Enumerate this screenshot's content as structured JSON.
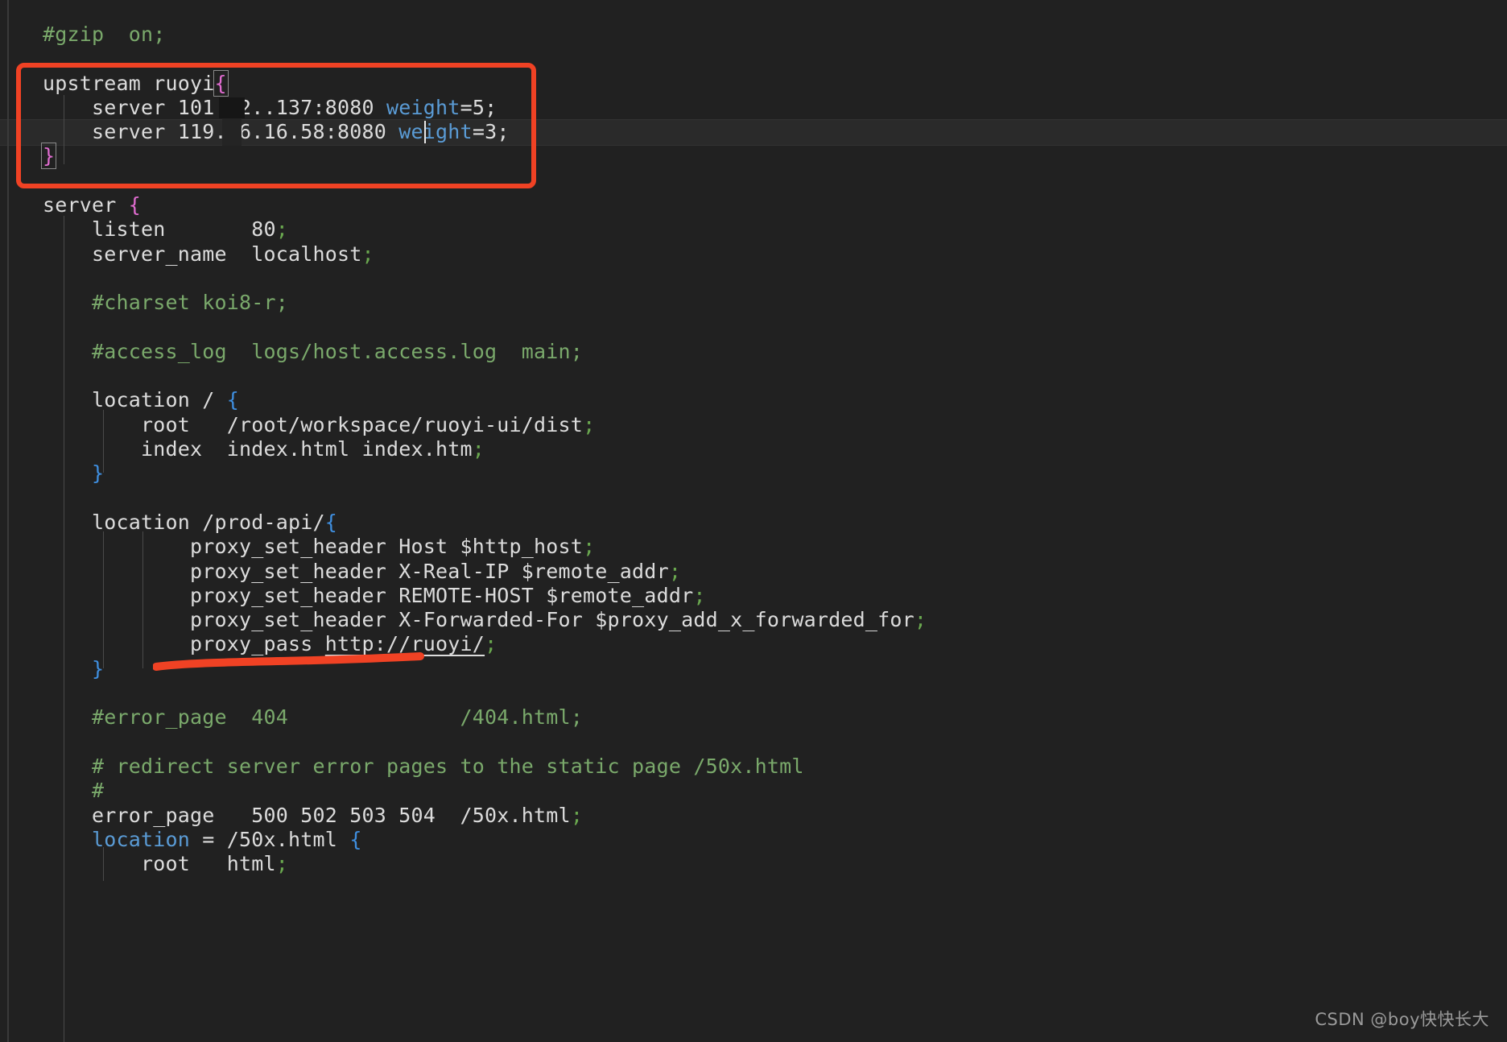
{
  "editor": {
    "background_color": "#212121",
    "foreground_color": "#d6d6d6",
    "comment_color": "#7aa96b",
    "keyword_color": "#5a9bd5",
    "brace_blue_color": "#3f8fe0",
    "brace_magenta_color": "#e06cd0",
    "punctuation_color": "#6aa84f",
    "annotation_color": "#f04224",
    "current_line_color": "#2a2a2a"
  },
  "code": {
    "language": "nginx",
    "lines": [
      {
        "id": "l01",
        "text": "#gzip  on;"
      },
      {
        "id": "l02",
        "text": ""
      },
      {
        "id": "l03",
        "text": "upstream ruoyi{"
      },
      {
        "id": "l04",
        "text": "    server 101.42.   .137:8080 weight=5;"
      },
      {
        "id": "l05",
        "text": "    server 119.96.1 6.58:8080 weight=3;"
      },
      {
        "id": "l06",
        "text": "}"
      },
      {
        "id": "l07",
        "text": ""
      },
      {
        "id": "l08",
        "text": "server {"
      },
      {
        "id": "l09",
        "text": "    listen       80;"
      },
      {
        "id": "l10",
        "text": "    server_name  localhost;"
      },
      {
        "id": "l11",
        "text": ""
      },
      {
        "id": "l12",
        "text": "    #charset koi8-r;"
      },
      {
        "id": "l13",
        "text": ""
      },
      {
        "id": "l14",
        "text": "    #access_log  logs/host.access.log  main;"
      },
      {
        "id": "l15",
        "text": ""
      },
      {
        "id": "l16",
        "text": "    location / {"
      },
      {
        "id": "l17",
        "text": "        root   /root/workspace/ruoyi-ui/dist;"
      },
      {
        "id": "l18",
        "text": "        index  index.html index.htm;"
      },
      {
        "id": "l19",
        "text": "    }"
      },
      {
        "id": "l20",
        "text": ""
      },
      {
        "id": "l21",
        "text": "    location /prod-api/{"
      },
      {
        "id": "l22",
        "text": "            proxy_set_header Host $http_host;"
      },
      {
        "id": "l23",
        "text": "            proxy_set_header X-Real-IP $remote_addr;"
      },
      {
        "id": "l24",
        "text": "            proxy_set_header REMOTE-HOST $remote_addr;"
      },
      {
        "id": "l25",
        "text": "            proxy_set_header X-Forwarded-For $proxy_add_x_forwarded_for;"
      },
      {
        "id": "l26",
        "text": "            proxy_pass http://ruoyi/;"
      },
      {
        "id": "l27",
        "text": "    }"
      },
      {
        "id": "l28",
        "text": ""
      },
      {
        "id": "l29",
        "text": "    #error_page  404              /404.html;"
      },
      {
        "id": "l30",
        "text": ""
      },
      {
        "id": "l31",
        "text": "    # redirect server error pages to the static page /50x.html"
      },
      {
        "id": "l32",
        "text": "    #"
      },
      {
        "id": "l33",
        "text": "    error_page   500 502 503 504  /50x.html;"
      },
      {
        "id": "l34",
        "text": "    location = /50x.html {"
      },
      {
        "id": "l35",
        "text": "        root   html;"
      }
    ],
    "tokens": {
      "gzip_comment": "#gzip  on;",
      "upstream_decl": "upstream ruoyi",
      "upstream_open_brace": "{",
      "upstream_close_brace": "}",
      "server_1_directive": "    server 101.42.",
      "server_1_ip_tail": ".137:8080 ",
      "server_1_keyword": "weight",
      "server_1_value": "=5;",
      "server_2_directive": "    server 119.96.1",
      "server_2_ip_tail": "6.58:8080 ",
      "server_2_keyword": "weight",
      "server_2_value": "=3;",
      "server_block": "server ",
      "server_block_brace": "{",
      "listen_line": "    listen       80",
      "listen_semi": ";",
      "server_name_line": "    server_name  localhost",
      "server_name_semi": ";",
      "charset_comment": "    #charset koi8-r;",
      "access_log_comment": "    #access_log  logs/host.access.log  main;",
      "location_root": "    location / ",
      "location_root_brace": "{",
      "root_dist": "        root   /root/workspace/ruoyi-ui/dist",
      "root_dist_semi": ";",
      "index_line": "        index  index.html index.htm",
      "index_semi": ";",
      "location_root_close": "    }",
      "location_prod": "    location /prod-api/",
      "location_prod_brace": "{",
      "psh_host": "            proxy_set_header Host $http_host",
      "psh_host_semi": ";",
      "psh_realip": "            proxy_set_header X-Real-IP $remote_addr",
      "psh_realip_semi": ";",
      "psh_remotehost": "            proxy_set_header REMOTE-HOST $remote_addr",
      "psh_remotehost_semi": ";",
      "psh_xff": "            proxy_set_header X-Forwarded-For $proxy_add_x_forwarded_for",
      "psh_xff_semi": ";",
      "proxy_pass_label": "            proxy_pass ",
      "proxy_pass_url": "http://ruoyi/",
      "proxy_pass_semi": ";",
      "location_prod_close": "    }",
      "error_page_comment": "    #error_page  404              /404.html;",
      "redirect_comment": "    # redirect server error pages to the static page /50x.html",
      "hash_comment": "    #",
      "error_page_line": "    error_page   500 502 503 504  /50x.html",
      "error_page_semi": ";",
      "location_50x_indent": "    ",
      "location_50x_keyword": "location",
      "location_50x_path": " = /50x.html ",
      "location_50x_brace": "{",
      "root_html": "        root   html",
      "root_html_semi": ";"
    }
  },
  "annotations": {
    "highlight_rect_label": "upstream-block-highlight",
    "underline_label": "proxy-pass-underline"
  },
  "watermark": {
    "text": "CSDN @boy快快长大"
  }
}
